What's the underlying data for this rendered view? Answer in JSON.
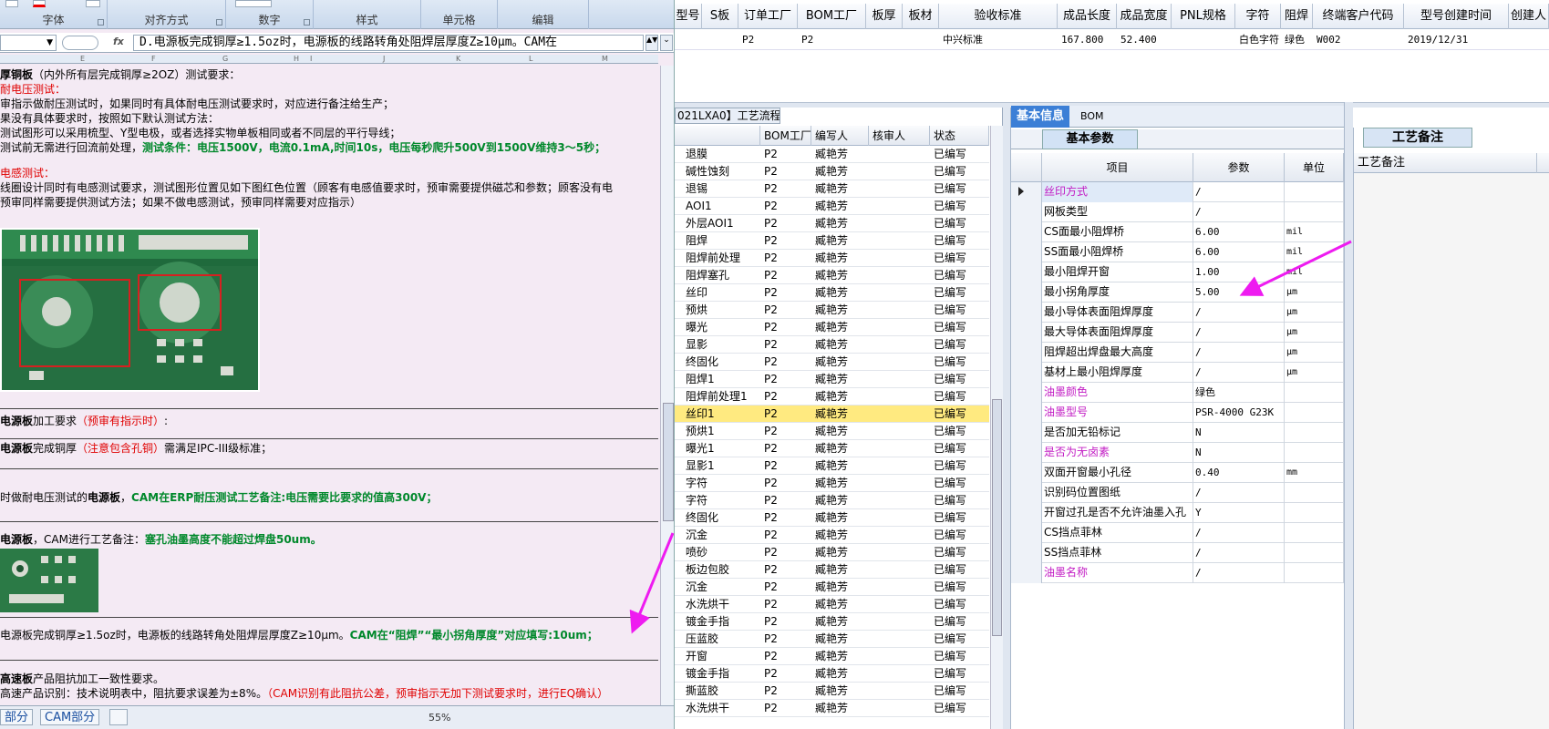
{
  "excel": {
    "ribbon_groups": [
      "字体",
      "对齐方式",
      "数字",
      "样式",
      "单元格",
      "编辑"
    ],
    "formula_bar": {
      "fx": "fx",
      "formula": "D.电源板完成铜厚≥1.5oz时，电源板的线路转角处阻焊层厚度Z≥10μm。CAM在"
    },
    "columns": [
      "E",
      "F",
      "G",
      "H",
      "I",
      "J",
      "K",
      "L",
      "M"
    ],
    "lines": [
      {
        "parts": [
          {
            "t": "厚铜板",
            "c": "b"
          },
          {
            "t": "（内外所有层完成铜厚≥2OZ）测试要求：",
            "c": ""
          }
        ]
      },
      {
        "parts": [
          {
            "t": "耐电压测试：",
            "c": "red"
          }
        ]
      },
      {
        "parts": [
          {
            "t": "审指示做耐压测试时，如果同时有具体耐电压测试要求时，对应进行备注给生产；",
            "c": ""
          }
        ]
      },
      {
        "parts": [
          {
            "t": "果没有具体要求时，按照如下默认测试方法：",
            "c": ""
          }
        ]
      },
      {
        "parts": [
          {
            "t": "测试图形可以采用梳型、Y型电极，或者选择实物单板相同或者不同层的平行导线；",
            "c": ""
          }
        ]
      },
      {
        "parts": [
          {
            "t": "测试前无需进行回流前处理，",
            "c": ""
          },
          {
            "t": "测试条件：电压1500V，电流0.1mA,时间10s，电压每秒爬升500V到1500V维持3～5秒；",
            "c": "grn"
          }
        ]
      },
      {
        "parts": [
          {
            "t": "电感测试：",
            "c": "red"
          }
        ]
      },
      {
        "parts": [
          {
            "t": "线圈设计同时有电感测试要求，测试图形位置见如下图红色位置（顾客有电感值要求时，预审需要提供磁芯和参数；顾客没有电",
            "c": ""
          }
        ]
      },
      {
        "parts": [
          {
            "t": "  预审同样需要提供测试方法；如果不做电感测试，预审同样需要对应指示）",
            "c": ""
          }
        ]
      },
      {
        "parts": [
          {
            "t": "电源板",
            "c": "b"
          },
          {
            "t": "加工要求",
            "c": ""
          },
          {
            "t": "（预审有指示时）",
            "c": "red"
          },
          {
            "t": ":",
            "c": ""
          }
        ]
      },
      {
        "parts": [
          {
            "t": "电源板",
            "c": "b"
          },
          {
            "t": "完成铜厚",
            "c": ""
          },
          {
            "t": "（注意包含孔铜）",
            "c": "red"
          },
          {
            "t": "需满足IPC-III级标准；",
            "c": ""
          }
        ]
      },
      {
        "parts": [
          {
            "t": "时做耐电压测试的",
            "c": ""
          },
          {
            "t": "电源板",
            "c": "b"
          },
          {
            "t": "，",
            "c": ""
          },
          {
            "t": "CAM在ERP耐压测试工艺备注:电压需要比要求的值高300V；",
            "c": "grn"
          }
        ]
      },
      {
        "parts": [
          {
            "t": " 电源板",
            "c": "b"
          },
          {
            "t": "，CAM进行工艺备注：",
            "c": ""
          },
          {
            "t": "塞孔油墨高度不能超过焊盘50um。",
            "c": "grn"
          }
        ]
      },
      {
        "parts": [
          {
            "t": "电源板完成铜厚≥1.5oz时，电源板的线路转角处阻焊层厚度Z≥10μm。",
            "c": ""
          },
          {
            "t": "CAM在“阻焊”“最小拐角厚度”对应填写:10um；",
            "c": "grn"
          }
        ]
      },
      {
        "parts": [
          {
            "t": "高速板",
            "c": "b"
          },
          {
            "t": "产品阻抗加工一致性要求。",
            "c": ""
          }
        ]
      },
      {
        "parts": [
          {
            "t": "高速产品识别：技术说明表中，阻抗要求误差为±8%。",
            "c": ""
          },
          {
            "t": "（CAM识别有此阻抗公差，预审指示无加下测试要求时，进行EQ确认）",
            "c": "red"
          }
        ]
      }
    ],
    "sheet_tabs": [
      "部分",
      "CAM部分"
    ],
    "zoom": "55%"
  },
  "erp": {
    "top_headers": [
      "型号",
      "S板",
      "订单工厂",
      "BOM工厂",
      "板厚",
      "板材",
      "验收标准",
      "成品长度",
      "成品宽度",
      "PNL规格",
      "字符",
      "阻焊",
      "终端客户代码",
      "型号创建时间",
      "创建人"
    ],
    "top_row": [
      "",
      "",
      "P2",
      "P2",
      "",
      "",
      "中兴标准",
      "167.800",
      "52.400",
      "",
      "白色字符",
      "绿色",
      "W002",
      "2019/12/31",
      ""
    ],
    "process": {
      "title": "021LXA0】工艺流程",
      "headers": [
        "",
        "BOM工厂",
        "编写人",
        "核审人",
        "状态"
      ],
      "rows": [
        [
          "退膜",
          "P2",
          "臧艳芳",
          "",
          "已编写"
        ],
        [
          "碱性蚀刻",
          "P2",
          "臧艳芳",
          "",
          "已编写"
        ],
        [
          "退锡",
          "P2",
          "臧艳芳",
          "",
          "已编写"
        ],
        [
          "AOI1",
          "P2",
          "臧艳芳",
          "",
          "已编写"
        ],
        [
          "外层AOI1",
          "P2",
          "臧艳芳",
          "",
          "已编写"
        ],
        [
          "阻焊",
          "P2",
          "臧艳芳",
          "",
          "已编写"
        ],
        [
          "阻焊前处理",
          "P2",
          "臧艳芳",
          "",
          "已编写"
        ],
        [
          "阻焊塞孔",
          "P2",
          "臧艳芳",
          "",
          "已编写"
        ],
        [
          "丝印",
          "P2",
          "臧艳芳",
          "",
          "已编写"
        ],
        [
          "预烘",
          "P2",
          "臧艳芳",
          "",
          "已编写"
        ],
        [
          "曝光",
          "P2",
          "臧艳芳",
          "",
          "已编写"
        ],
        [
          "显影",
          "P2",
          "臧艳芳",
          "",
          "已编写"
        ],
        [
          "终固化",
          "P2",
          "臧艳芳",
          "",
          "已编写"
        ],
        [
          "阻焊1",
          "P2",
          "臧艳芳",
          "",
          "已编写"
        ],
        [
          "阻焊前处理1",
          "P2",
          "臧艳芳",
          "",
          "已编写"
        ],
        [
          "丝印1",
          "P2",
          "臧艳芳",
          "",
          "已编写"
        ],
        [
          "预烘1",
          "P2",
          "臧艳芳",
          "",
          "已编写"
        ],
        [
          "曝光1",
          "P2",
          "臧艳芳",
          "",
          "已编写"
        ],
        [
          "显影1",
          "P2",
          "臧艳芳",
          "",
          "已编写"
        ],
        [
          "字符",
          "P2",
          "臧艳芳",
          "",
          "已编写"
        ],
        [
          "字符",
          "P2",
          "臧艳芳",
          "",
          "已编写"
        ],
        [
          "终固化",
          "P2",
          "臧艳芳",
          "",
          "已编写"
        ],
        [
          "沉金",
          "P2",
          "臧艳芳",
          "",
          "已编写"
        ],
        [
          "喷砂",
          "P2",
          "臧艳芳",
          "",
          "已编写"
        ],
        [
          "板边包胶",
          "P2",
          "臧艳芳",
          "",
          "已编写"
        ],
        [
          "沉金",
          "P2",
          "臧艳芳",
          "",
          "已编写"
        ],
        [
          "水洗烘干",
          "P2",
          "臧艳芳",
          "",
          "已编写"
        ],
        [
          "镀金手指",
          "P2",
          "臧艳芳",
          "",
          "已编写"
        ],
        [
          "压蓝胶",
          "P2",
          "臧艳芳",
          "",
          "已编写"
        ],
        [
          "开窗",
          "P2",
          "臧艳芳",
          "",
          "已编写"
        ],
        [
          "镀金手指",
          "P2",
          "臧艳芳",
          "",
          "已编写"
        ],
        [
          "撕蓝胶",
          "P2",
          "臧艳芳",
          "",
          "已编写"
        ],
        [
          "水洗烘干",
          "P2",
          "臧艳芳",
          "",
          "已编写"
        ]
      ],
      "selected_index": 15
    },
    "info": {
      "tabs": [
        "基本信息",
        "BOM"
      ],
      "subtab": "基本参数",
      "headers": [
        "项目",
        "参数",
        "单位"
      ],
      "rows": [
        {
          "item": "丝印方式",
          "val": "/",
          "unit": "",
          "hl": true
        },
        {
          "item": "网板类型",
          "val": "/",
          "unit": "",
          "hl": false
        },
        {
          "item": "CS面最小阻焊桥",
          "val": "6.00",
          "unit": "mil",
          "hl": false
        },
        {
          "item": "SS面最小阻焊桥",
          "val": "6.00",
          "unit": "mil",
          "hl": false
        },
        {
          "item": "最小阻焊开窗",
          "val": "1.00",
          "unit": "mil",
          "hl": false
        },
        {
          "item": "最小拐角厚度",
          "val": "5.00",
          "unit": "μm",
          "hl": false
        },
        {
          "item": "最小导体表面阻焊厚度",
          "val": "/",
          "unit": "μm",
          "hl": false
        },
        {
          "item": "最大导体表面阻焊厚度",
          "val": "/",
          "unit": "μm",
          "hl": false
        },
        {
          "item": "阻焊超出焊盘最大高度",
          "val": "/",
          "unit": "μm",
          "hl": false
        },
        {
          "item": "基材上最小阻焊厚度",
          "val": "/",
          "unit": "μm",
          "hl": false
        },
        {
          "item": "油墨颜色",
          "val": "绿色",
          "unit": "",
          "hl": true
        },
        {
          "item": "油墨型号",
          "val": "PSR-4000 G23K",
          "unit": "",
          "hl": true
        },
        {
          "item": "是否加无铅标记",
          "val": "N",
          "unit": "",
          "hl": false
        },
        {
          "item": "是否为无卤素",
          "val": "N",
          "unit": "",
          "hl": true
        },
        {
          "item": "双面开窗最小孔径",
          "val": "0.40",
          "unit": "mm",
          "hl": false
        },
        {
          "item": "识别码位置图纸",
          "val": "/",
          "unit": "",
          "hl": false
        },
        {
          "item": "开窗过孔是否不允许油墨入孔",
          "val": "Y",
          "unit": "",
          "hl": false
        },
        {
          "item": "CS挡点菲林",
          "val": "/",
          "unit": "",
          "hl": false
        },
        {
          "item": "SS挡点菲林",
          "val": "/",
          "unit": "",
          "hl": false
        },
        {
          "item": "油墨名称",
          "val": "/",
          "unit": "",
          "hl": true
        }
      ]
    },
    "remarks": {
      "tab": "工艺备注",
      "header": "工艺备注"
    }
  },
  "colors": {
    "arrow": "#ee1bf0",
    "selected_row": "#ffea80",
    "active_tab": "#3c7fd6",
    "highlight_text": "#c21cc4",
    "green_text": "#00882b"
  }
}
